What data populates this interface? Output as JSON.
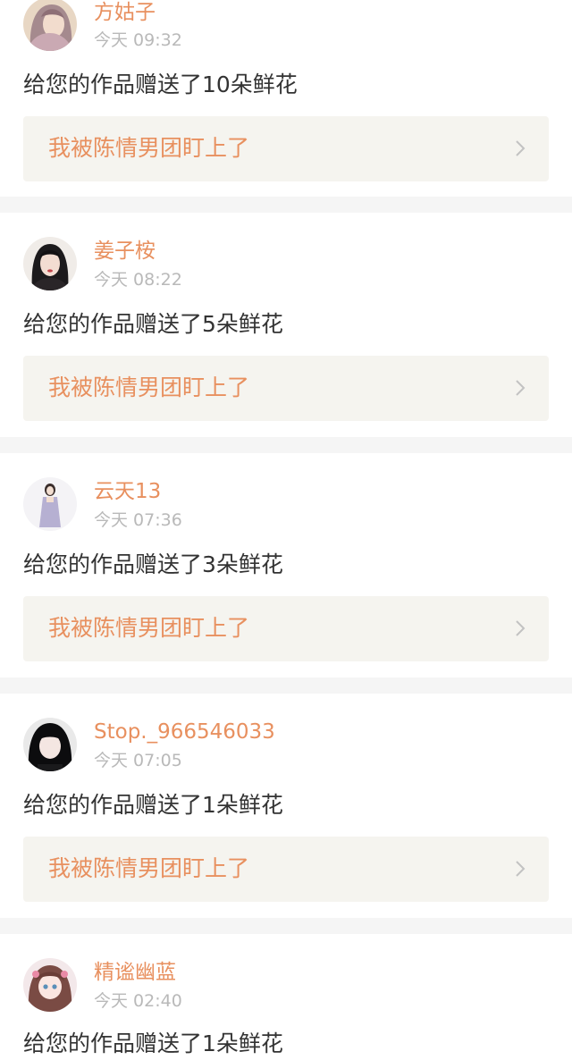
{
  "notifications": [
    {
      "username": "方姑子",
      "time": "今天 09:32",
      "message": "给您的作品赠送了10朵鲜花",
      "work_title": "我被陈情男团盯上了",
      "avatar_icon": "avatar-long-hair-icon"
    },
    {
      "username": "姜子桉",
      "time": "今天 08:22",
      "message": "给您的作品赠送了5朵鲜花",
      "work_title": "我被陈情男团盯上了",
      "avatar_icon": "avatar-dark-hair-icon"
    },
    {
      "username": "云天13",
      "time": "今天 07:36",
      "message": "给您的作品赠送了3朵鲜花",
      "work_title": "我被陈情男团盯上了",
      "avatar_icon": "avatar-full-body-icon"
    },
    {
      "username": "Stop._966546033",
      "time": "今天 07:05",
      "message": "给您的作品赠送了1朵鲜花",
      "work_title": "我被陈情男团盯上了",
      "avatar_icon": "avatar-black-hair-icon"
    },
    {
      "username": "精谧幽蓝",
      "time": "今天 02:40",
      "message": "给您的作品赠送了1朵鲜花",
      "work_title": "",
      "avatar_icon": "avatar-anime-girl-icon"
    }
  ],
  "colors": {
    "accent": "#e8905f",
    "message_text": "#333333",
    "time_text": "#b9b9b9",
    "card_bg": "#f5f4ef",
    "page_bg": "#f5f5f5"
  }
}
